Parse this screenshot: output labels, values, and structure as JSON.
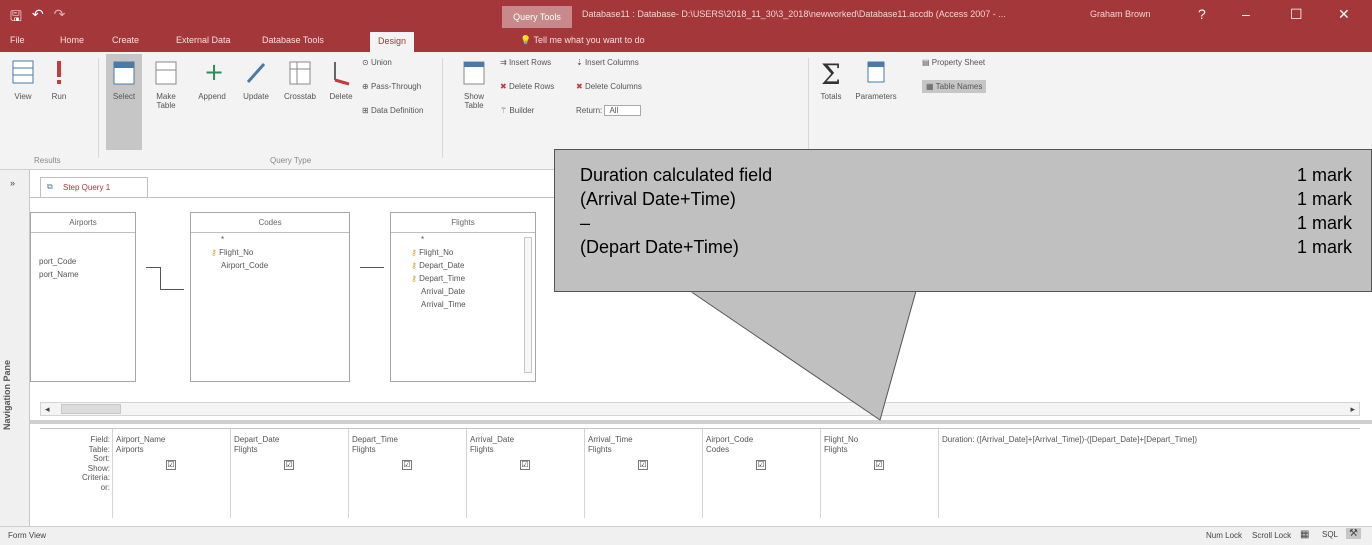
{
  "window": {
    "title": "Database11 : Database- D:\\USERS\\2018_11_30\\3_2018\\newworked\\Database11.accdb (Access 2007 - ...",
    "context_tab": "Query Tools",
    "user": "Graham Brown",
    "help": "?",
    "min": "–",
    "max": "☐",
    "close": "✕"
  },
  "tabs": [
    "File",
    "Home",
    "Create",
    "External Data",
    "Database Tools",
    "Design"
  ],
  "tell_me": "Tell me what you want to do",
  "ribbon": {
    "view": "View",
    "run": "Run",
    "select": "Select",
    "make_table": "Make Table",
    "append": "Append",
    "update": "Update",
    "crosstab": "Crosstab",
    "delete": "Delete",
    "union": "Union",
    "pass_through": "Pass-Through",
    "data_definition": "Data Definition",
    "show_table": "Show Table",
    "insert_rows": "Insert Rows",
    "delete_rows": "Delete Rows",
    "builder": "Builder",
    "insert_columns": "Insert Columns",
    "delete_columns": "Delete Columns",
    "return": "Return:",
    "return_value": "All",
    "totals": "Totals",
    "parameters": "Parameters",
    "property_sheet": "Property Sheet",
    "table_names": "Table Names",
    "group_results": "Results",
    "group_query_type": "Query Type"
  },
  "nav_pane": "Navigation Pane",
  "doc_tab": "Step Query 1",
  "tables": {
    "airports": {
      "title": "Airports",
      "fields": [
        "port_Code",
        "port_Name"
      ]
    },
    "codes": {
      "title": "Codes",
      "fields": [
        "*",
        "Flight_No",
        "Airport_Code"
      ]
    },
    "flights": {
      "title": "Flights",
      "fields": [
        "*",
        "Flight_No",
        "Depart_Date",
        "Depart_Time",
        "Arrival_Date",
        "Arrival_Time"
      ]
    }
  },
  "grid": {
    "row_labels": [
      "Field:",
      "Table:",
      "Sort:",
      "Show:",
      "Criteria:",
      "or:"
    ],
    "columns": [
      {
        "field": "Airport_Name",
        "table": "Airports"
      },
      {
        "field": "Depart_Date",
        "table": "Flights"
      },
      {
        "field": "Depart_Time",
        "table": "Flights"
      },
      {
        "field": "Arrival_Date",
        "table": "Flights"
      },
      {
        "field": "Arrival_Time",
        "table": "Flights"
      },
      {
        "field": "Airport_Code",
        "table": "Codes"
      },
      {
        "field": "Flight_No",
        "table": "Flights"
      },
      {
        "field": "Duration: ([Arrival_Date]+[Arrival_Time])-([Depart_Date]+[Depart_Time])",
        "table": ""
      }
    ],
    "check": "☑"
  },
  "status": {
    "left": "Form View",
    "num_lock": "Num Lock",
    "scroll_lock": "Scroll Lock"
  },
  "callout": {
    "lines": [
      {
        "text": "Duration calculated field",
        "mark": "1 mark"
      },
      {
        "text": "(Arrival Date+Time)",
        "mark": "1 mark"
      },
      {
        "text": "–",
        "mark": "1 mark"
      },
      {
        "text": "(Depart Date+Time)",
        "mark": "1 mark"
      }
    ]
  },
  "colors": {
    "accent": "#a4373a",
    "callout": "#c0c0c0"
  }
}
